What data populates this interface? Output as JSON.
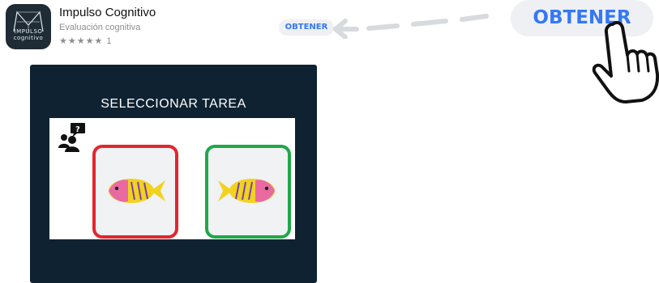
{
  "app": {
    "name": "Impulso Cognitivo",
    "subtitle": "Evaluación cognitiva",
    "rating_stars": "★★★★★",
    "rating_count": "1",
    "icon_text_line1": "IMPULSO",
    "icon_text_line2": "cognitivo"
  },
  "get_button_small": {
    "label": "OBTENER"
  },
  "get_button_large": {
    "label": "OBTENER"
  },
  "task_panel": {
    "title": "SELECCIONAR TAREA"
  },
  "icons": {
    "arrow": "arrow-left-icon",
    "hand": "hand-pointer-icon",
    "user": "user-question-icon",
    "fish": "fish-icon"
  },
  "colors": {
    "accent": "#3478f6",
    "panel_bg": "#0f2232",
    "card_red": "#e2262e",
    "card_green": "#20a84a",
    "fish_pink": "#e86aa0",
    "fish_yellow": "#f1d21f"
  }
}
